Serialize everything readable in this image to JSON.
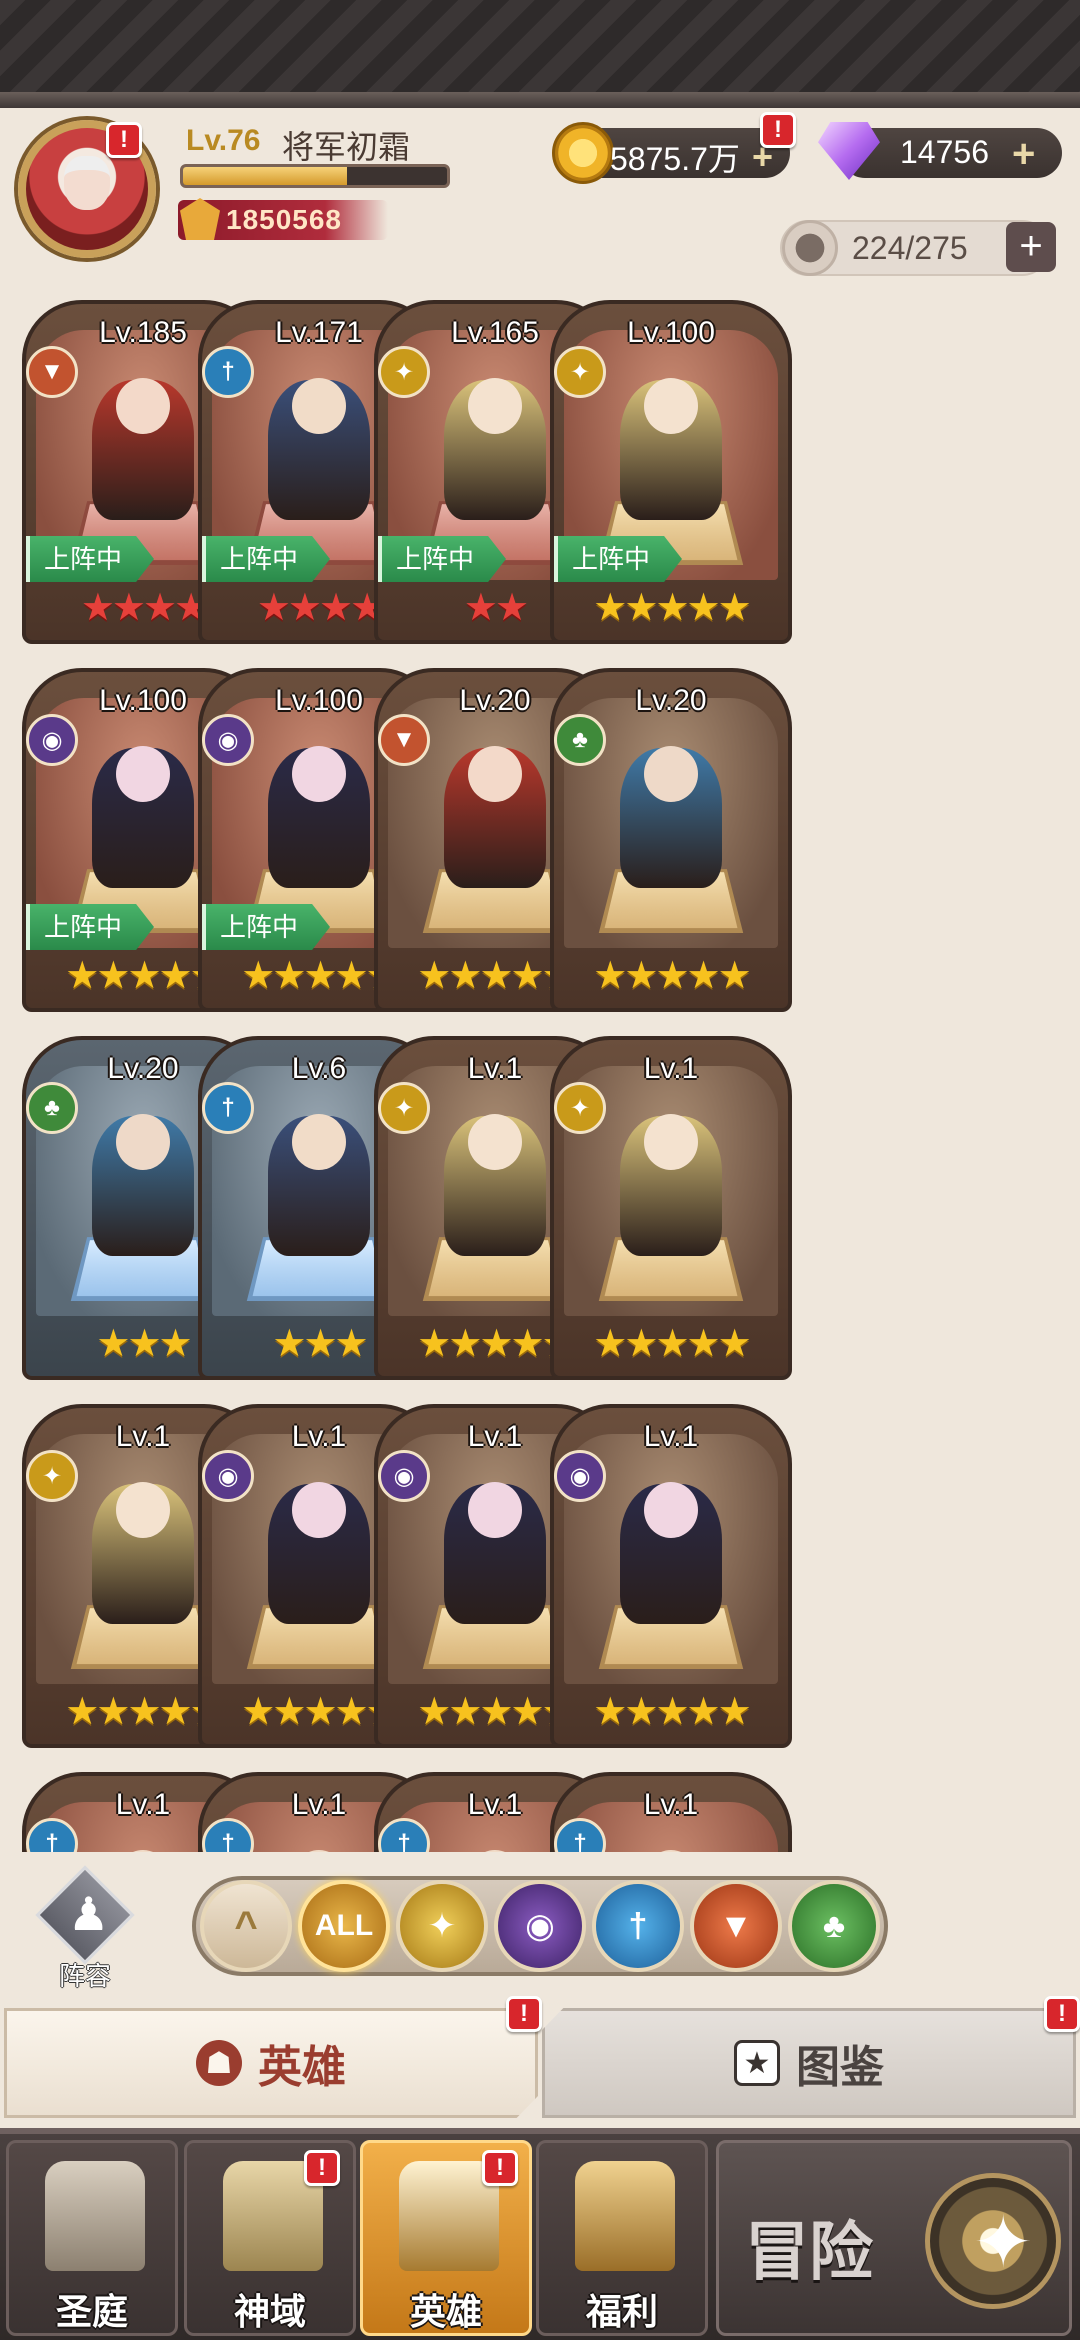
{
  "player": {
    "level": "Lv.76",
    "name": "将军初霜",
    "power": "1850568",
    "xp_fraction": 0.62,
    "avatar_alert": "!"
  },
  "currency": {
    "gold": "5875.7万",
    "gold_alert": "!",
    "gems": "14756",
    "plus": "+"
  },
  "capacity": {
    "value": "224/275",
    "plus": "+"
  },
  "heroes": [
    {
      "level": "Lv.185",
      "faction": "fox",
      "stars": 4,
      "star_color": "red",
      "deployed": true,
      "alert": true
    },
    {
      "level": "Lv.171",
      "faction": "sword",
      "stars": 4,
      "star_color": "red",
      "deployed": true,
      "alert": true
    },
    {
      "level": "Lv.165",
      "faction": "sun",
      "stars": 2,
      "star_color": "red",
      "deployed": true,
      "alert": false
    },
    {
      "level": "Lv.100",
      "faction": "sun",
      "stars": 5,
      "star_color": "gold",
      "deployed": true,
      "alert": false
    },
    {
      "level": "Lv.100",
      "faction": "dark",
      "stars": 5,
      "star_color": "gold",
      "deployed": true,
      "alert": false
    },
    {
      "level": "Lv.100",
      "faction": "dark",
      "stars": 5,
      "star_color": "gold",
      "deployed": true,
      "alert": false
    },
    {
      "level": "Lv.20",
      "faction": "fox",
      "stars": 5,
      "star_color": "gold",
      "deployed": false,
      "alert": false
    },
    {
      "level": "Lv.20",
      "faction": "tree",
      "stars": 5,
      "star_color": "gold",
      "deployed": false,
      "alert": false
    },
    {
      "level": "Lv.20",
      "faction": "tree",
      "stars": 3,
      "star_color": "gold",
      "deployed": false,
      "alert": false
    },
    {
      "level": "Lv.6",
      "faction": "sword",
      "stars": 3,
      "star_color": "gold",
      "deployed": false,
      "alert": false
    },
    {
      "level": "Lv.1",
      "faction": "sun",
      "stars": 5,
      "star_color": "gold",
      "deployed": false,
      "alert": false
    },
    {
      "level": "Lv.1",
      "faction": "sun",
      "stars": 5,
      "star_color": "gold",
      "deployed": false,
      "alert": false
    },
    {
      "level": "Lv.1",
      "faction": "sun",
      "stars": 5,
      "star_color": "gold",
      "deployed": false,
      "alert": false
    },
    {
      "level": "Lv.1",
      "faction": "dark",
      "stars": 5,
      "star_color": "gold",
      "deployed": false,
      "alert": false
    },
    {
      "level": "Lv.1",
      "faction": "dark",
      "stars": 5,
      "star_color": "gold",
      "deployed": false,
      "alert": false
    },
    {
      "level": "Lv.1",
      "faction": "dark",
      "stars": 5,
      "star_color": "gold",
      "deployed": false,
      "alert": false
    },
    {
      "level": "Lv.1",
      "faction": "sword",
      "stars": 0,
      "star_color": "gold",
      "deployed": false,
      "alert": false
    },
    {
      "level": "Lv.1",
      "faction": "sword",
      "stars": 0,
      "star_color": "gold",
      "deployed": false,
      "alert": false
    },
    {
      "level": "Lv.1",
      "faction": "sword",
      "stars": 0,
      "star_color": "gold",
      "deployed": false,
      "alert": false
    },
    {
      "level": "Lv.1",
      "faction": "sword",
      "stars": 0,
      "star_color": "gold",
      "deployed": false,
      "alert": false
    }
  ],
  "deployed_label": "上阵中",
  "lineup_label": "阵容",
  "filters": {
    "up_icon": "^",
    "all_label": "ALL",
    "factions": [
      "sun",
      "dark",
      "sword",
      "fox",
      "tree"
    ]
  },
  "subtabs": {
    "heroes": "英雄",
    "codex": "图鉴",
    "alert": "!"
  },
  "nav": {
    "items": [
      "圣庭",
      "神域",
      "英雄",
      "福利"
    ],
    "adventure": "冒险",
    "alert": "!"
  },
  "colors": {
    "deployed_green": "#2a8a4a",
    "star_gold": "#f7c21e",
    "star_red": "#e6403a",
    "alert_red": "#d8262c",
    "nav_active": "#f2b04a"
  }
}
